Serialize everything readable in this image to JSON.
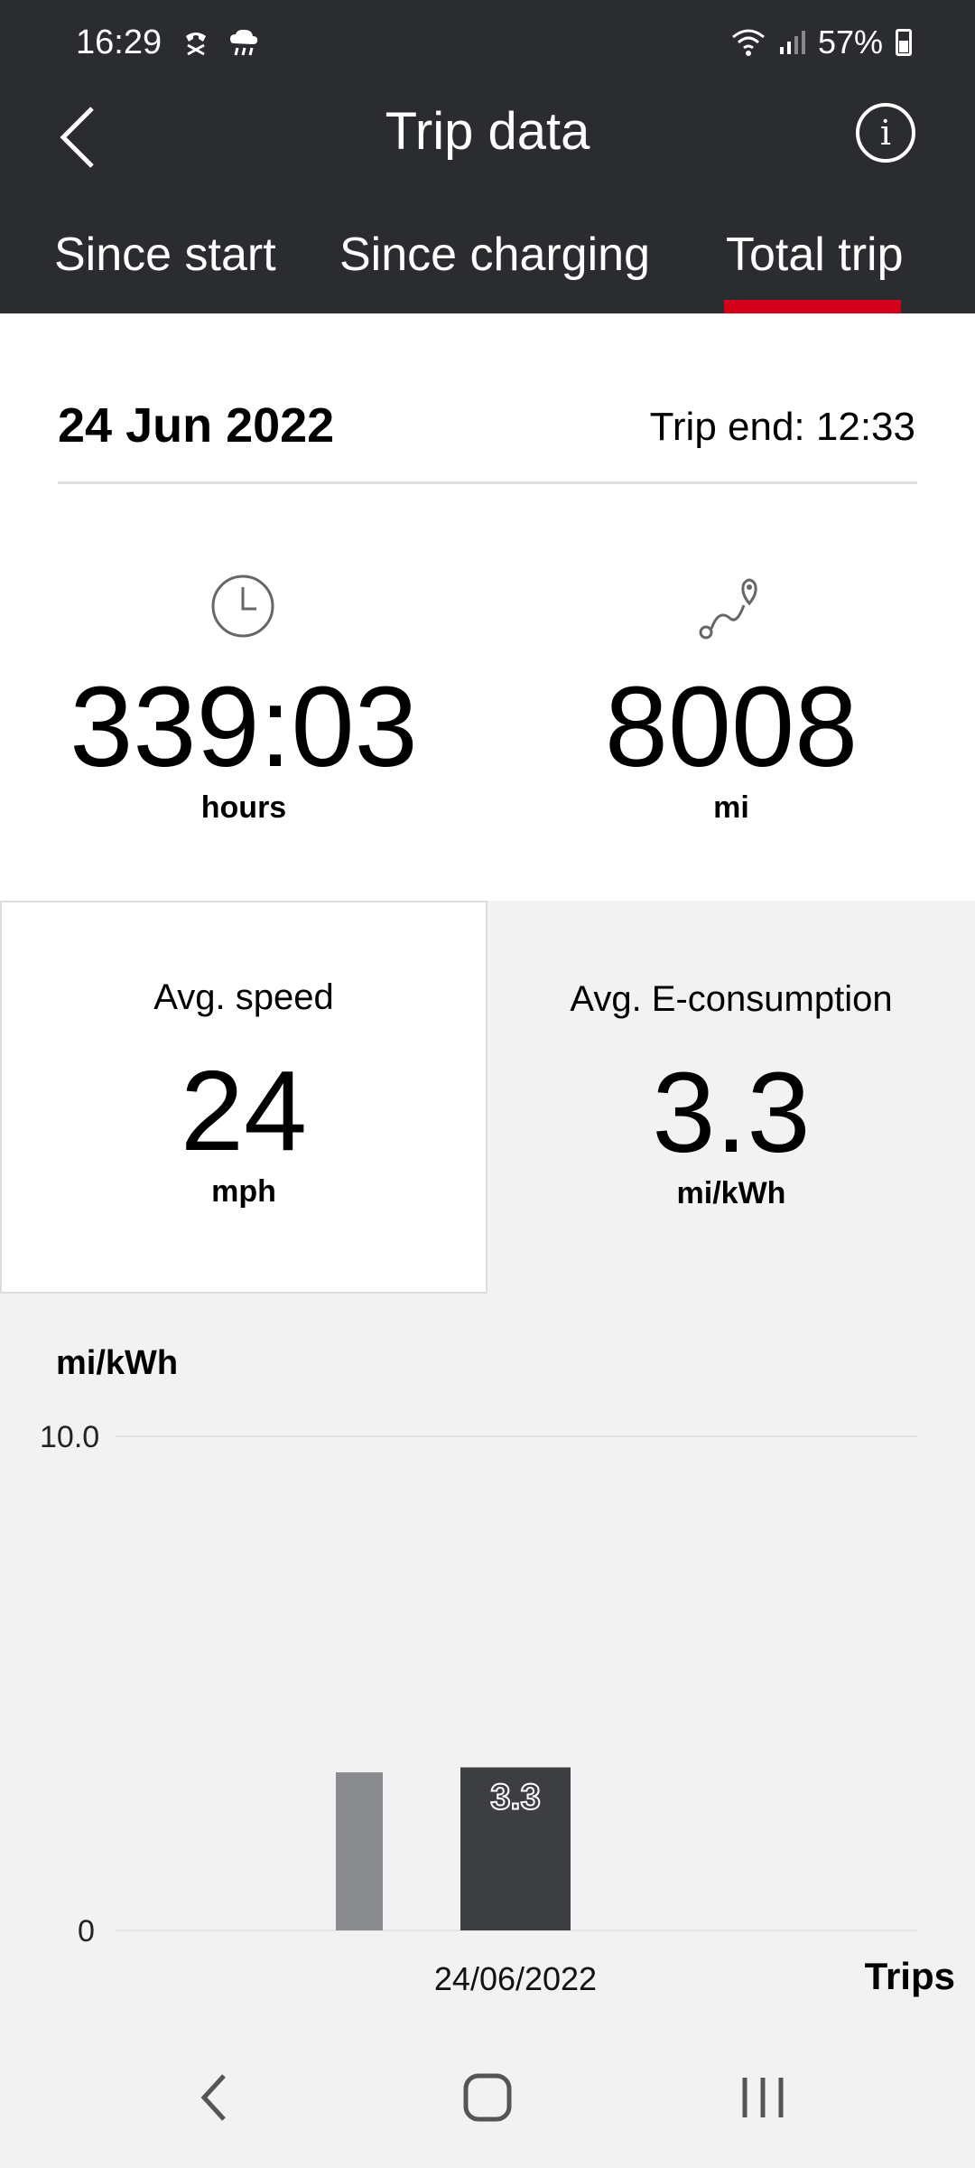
{
  "status": {
    "time": "16:29",
    "battery": "57%",
    "icons": [
      "call-muted-icon",
      "weather-icon",
      "wifi-icon",
      "signal-icon",
      "battery-icon"
    ]
  },
  "header": {
    "title": "Trip data"
  },
  "tabs": [
    "Since start",
    "Since charging",
    "Total trip"
  ],
  "active_tab": 2,
  "summary": {
    "date": "24 Jun 2022",
    "trip_end_label": "Trip end:",
    "trip_end_time": "12:33",
    "duration": {
      "value": "339:03",
      "unit": "hours"
    },
    "distance": {
      "value": "8008",
      "unit": "mi"
    }
  },
  "tiles": {
    "speed": {
      "label": "Avg. speed",
      "value": "24",
      "unit": "mph"
    },
    "consumption": {
      "label": "Avg. E-consumption",
      "value": "3.3",
      "unit": "mi/kWh"
    }
  },
  "chart_data": {
    "type": "bar",
    "ylabel": "mi/kWh",
    "xlabel": "Trips",
    "ylim": [
      0,
      10.0
    ],
    "yticks": [
      "10.0",
      "0"
    ],
    "bars": [
      {
        "value": 3.2,
        "label": "",
        "color": "#8a8b8f"
      },
      {
        "value": 3.3,
        "label": "3.3",
        "category": "24/06/2022",
        "color": "#3d3e42"
      }
    ]
  },
  "colors": {
    "header_bg": "#2b2c30",
    "accent": "#d5001c",
    "page_bg": "#f2f2f2"
  }
}
